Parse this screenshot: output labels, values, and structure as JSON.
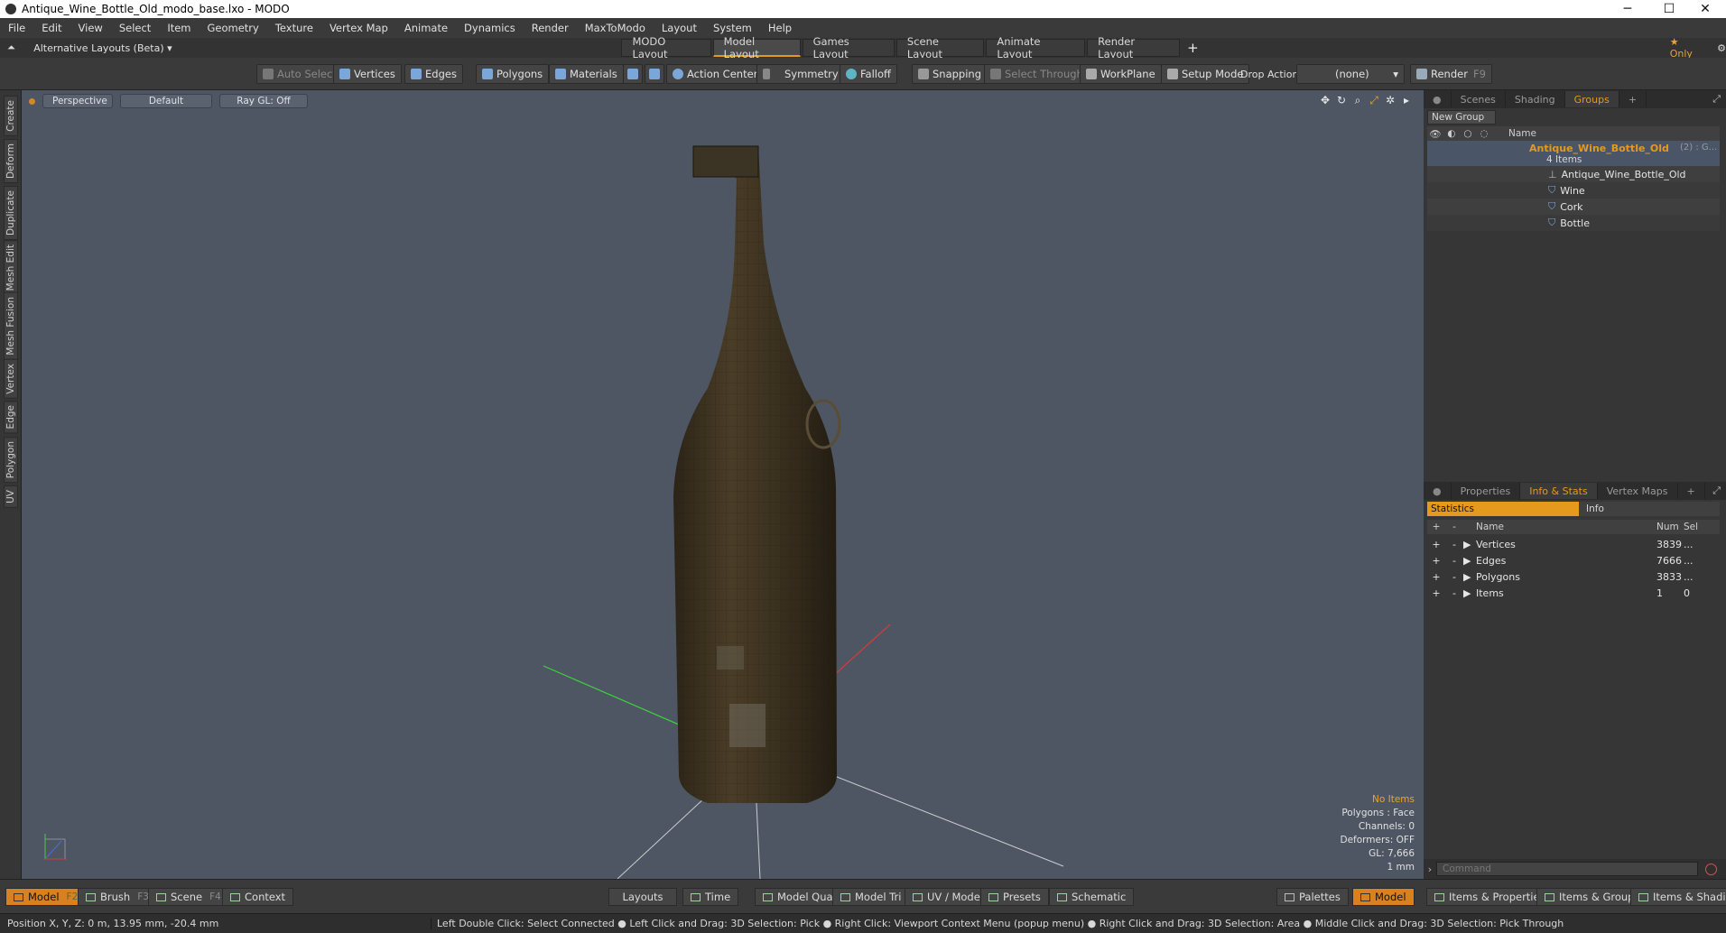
{
  "window": {
    "title": "Antique_Wine_Bottle_Old_modo_base.lxo - MODO",
    "minimize": "─",
    "maximize": "☐",
    "close": "✕"
  },
  "menu": [
    "File",
    "Edit",
    "View",
    "Select",
    "Item",
    "Geometry",
    "Texture",
    "Vertex Map",
    "Animate",
    "Dynamics",
    "Render",
    "MaxToModo",
    "Layout",
    "System",
    "Help"
  ],
  "layouts": {
    "selector": "Alternative Layouts (Beta) ▾",
    "tabs": [
      "MODO Layout",
      "Model Layout",
      "Games Layout",
      "Scene Layout",
      "Animate Layout",
      "Render Layout"
    ],
    "active_index": 1,
    "add": "+",
    "only_label": "★ Only",
    "gear": "⚙"
  },
  "toolbar": {
    "auto_select": "Auto Select",
    "vertices": "Vertices",
    "edges": "Edges",
    "polygons": "Polygons",
    "materials": "Materials",
    "action_center": "Action Center",
    "symmetry": "Symmetry",
    "falloff": "Falloff",
    "snapping": "Snapping",
    "select_through": "Select Through",
    "workplane": "WorkPlane",
    "setup_mode": "Setup Mode",
    "drop_action": "Drop Action",
    "drop_value": "(none)",
    "render": "Render",
    "render_key": "F9"
  },
  "left_tabs": [
    "Create",
    "Deform",
    "Duplicate",
    "Mesh Edit",
    "Mesh Fusion",
    "Vertex",
    "Edge",
    "Polygon",
    "UV"
  ],
  "viewport": {
    "view": "Perspective",
    "shading": "Default",
    "raygl": "Ray GL: Off",
    "hud": {
      "items": "No Items",
      "polygons": "Polygons : Face",
      "channels": "Channels: 0",
      "deformers": "Deformers: OFF",
      "gl": "GL: 7,666",
      "scale": "1 mm"
    }
  },
  "scene_panel": {
    "tabs": [
      "Scenes",
      "Shading",
      "Groups"
    ],
    "active_index": 2,
    "add": "+",
    "new_group": "New Group",
    "name_header": "Name",
    "group_name": "Antique_Wine_Bottle_Old",
    "group_suffix": "(2) : G...",
    "group_count": "4 Items",
    "children": [
      "Antique_Wine_Bottle_Old",
      "Wine",
      "Cork",
      "Bottle"
    ]
  },
  "props_panel": {
    "tabs": [
      "Properties",
      "Info & Stats",
      "Vertex Maps"
    ],
    "active_index": 1,
    "add": "+",
    "sub_tabs": [
      "Statistics",
      "Info"
    ],
    "headers": {
      "name": "Name",
      "num": "Num",
      "sel": "Sel"
    },
    "rows": [
      {
        "name": "Vertices",
        "num": "3839",
        "sel": "..."
      },
      {
        "name": "Edges",
        "num": "7666",
        "sel": "..."
      },
      {
        "name": "Polygons",
        "num": "3833",
        "sel": "..."
      },
      {
        "name": "Items",
        "num": "1",
        "sel": "0"
      }
    ],
    "command_placeholder": "Command"
  },
  "bottom": {
    "left": [
      {
        "label": "Model",
        "key": "F2"
      },
      {
        "label": "Brush",
        "key": "F3"
      },
      {
        "label": "Scene",
        "key": "F4"
      },
      {
        "label": "Context",
        "key": ""
      }
    ],
    "center": [
      "Layouts",
      "Time",
      "Model Quad",
      "Model Tri",
      "UV / Model",
      "Presets",
      "Schematic"
    ],
    "right": [
      "Palettes",
      "Model",
      "Items & Properties",
      "Items & Groups",
      "Items & Shading"
    ]
  },
  "status": {
    "position": "Position X, Y, Z:   0 m, 13.95 mm, -20.4 mm",
    "hints": "Left Double Click: Select Connected ● Left Click and Drag: 3D Selection: Pick ● Right Click: Viewport Context Menu (popup menu) ● Right Click and Drag: 3D Selection: Area ● Middle Click and Drag: 3D Selection: Pick Through"
  }
}
